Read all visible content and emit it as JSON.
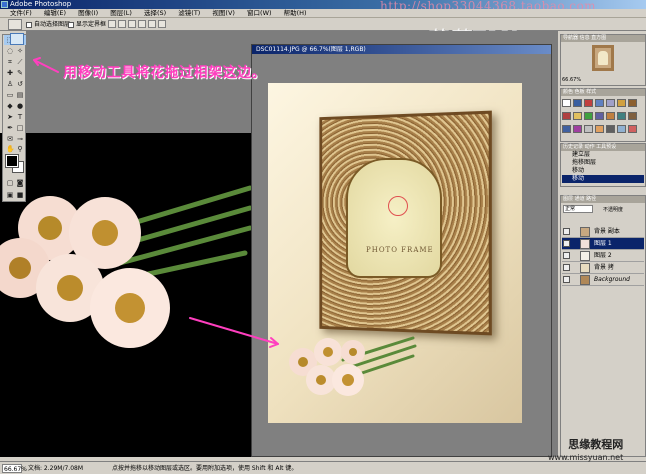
{
  "app": {
    "title": "Adobe Photoshop",
    "watermark_top": "http://shop33044368.taobao.com",
    "brand": "花菲FLY"
  },
  "menubar": {
    "items": [
      "文件(F)",
      "编辑(E)",
      "图像(I)",
      "图层(L)",
      "选择(S)",
      "滤镜(T)",
      "视图(V)",
      "窗口(W)",
      "帮助(H)"
    ]
  },
  "optbar": {
    "auto_select": "自动选择图层",
    "show_bounds": "显示定界框"
  },
  "annotation": "用移动工具将花拖过相架这边。",
  "document": {
    "title": "DSC01114.JPG @ 66.7%(图层 1,RGB)",
    "photo_text": "PHOTO FRAME"
  },
  "panels": {
    "navigator_tabs": "导航器 信息 直方图",
    "zoom": "66.67%",
    "swatch_tabs": "颜色 色板 样式",
    "history_tabs": "历史记录 动作 工具预设",
    "history": [
      "建立层",
      "拖移图层",
      "移动",
      "移动"
    ],
    "layers_tabs": "图层 通道 路径",
    "blend_mode": "正常",
    "opacity": "不透明度",
    "layers": [
      {
        "name": "背景 副本"
      },
      {
        "name": "图层 1"
      },
      {
        "name": "图层 2"
      },
      {
        "name": "背景 拷"
      },
      {
        "name": "Background"
      }
    ]
  },
  "status": {
    "zoom": "66.67%",
    "doc": "文档: 2.29M/7.08M",
    "hint": "点按并拖移以移动图层或选区。要用附加选项，使用 Shift 和 Alt 键。"
  },
  "site": {
    "name": "思缘教程网",
    "url": "www.missyuan.net"
  },
  "colors": {
    "annotation": "#ff3fbf",
    "titlebar": "#0a246a",
    "workspace": "#7d7d7d"
  }
}
